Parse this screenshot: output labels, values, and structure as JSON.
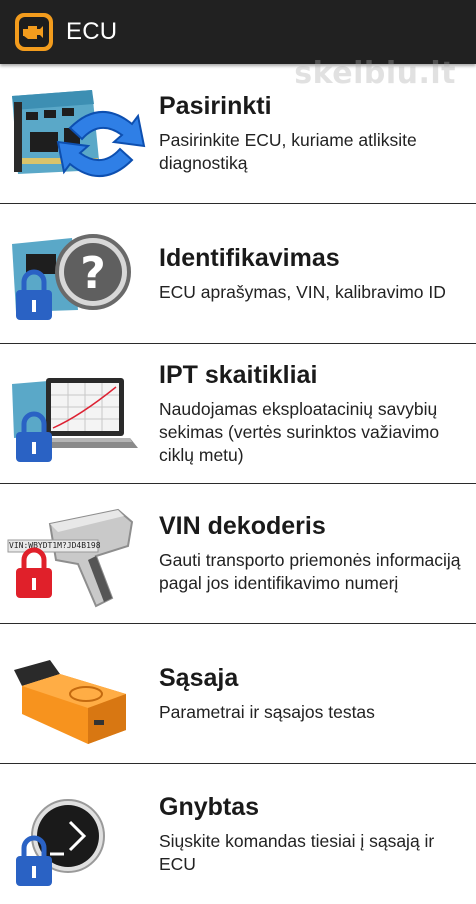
{
  "appbar": {
    "title": "ECU",
    "icon": "engine-check-icon"
  },
  "watermark": {
    "text": "skelbiu.lt"
  },
  "items": [
    {
      "title": "Pasirinkti",
      "desc": "Pasirinkite ECU, kuriame atliksite diagnostiką",
      "icon": "ecu-board-arrows-icon",
      "locked": false
    },
    {
      "title": "Identifikavimas",
      "desc": "ECU aprašymas, VIN, kalibravimo ID",
      "icon": "question-mark-icon",
      "locked": true
    },
    {
      "title": "IPT skaitikliai",
      "desc": "Naudojamas eksploatacinių savybių sekimas (vertės surinktos važiavimo ciklų metu)",
      "icon": "laptop-chart-icon",
      "locked": true
    },
    {
      "title": "VIN dekoderis",
      "desc": "Gauti transporto priemonės informaciją pagal jos identifikavimo numerį",
      "icon": "barcode-scanner-icon",
      "locked": true,
      "vin_label": "VIN:WBYDT1M?JD4B198"
    },
    {
      "title": "Sąsaja",
      "desc": "Parametrai ir sąsajos testas",
      "icon": "obd-adapter-icon",
      "locked": false
    },
    {
      "title": "Gnybtas",
      "desc": "Siųskite komandas tiesiai į sąsają ir ECU",
      "icon": "terminal-icon",
      "locked": true
    }
  ],
  "colors": {
    "appbar": "#212121",
    "lock_blue": "#2a62c4",
    "lock_red": "#e0202a",
    "adapter_orange": "#f7931e"
  }
}
